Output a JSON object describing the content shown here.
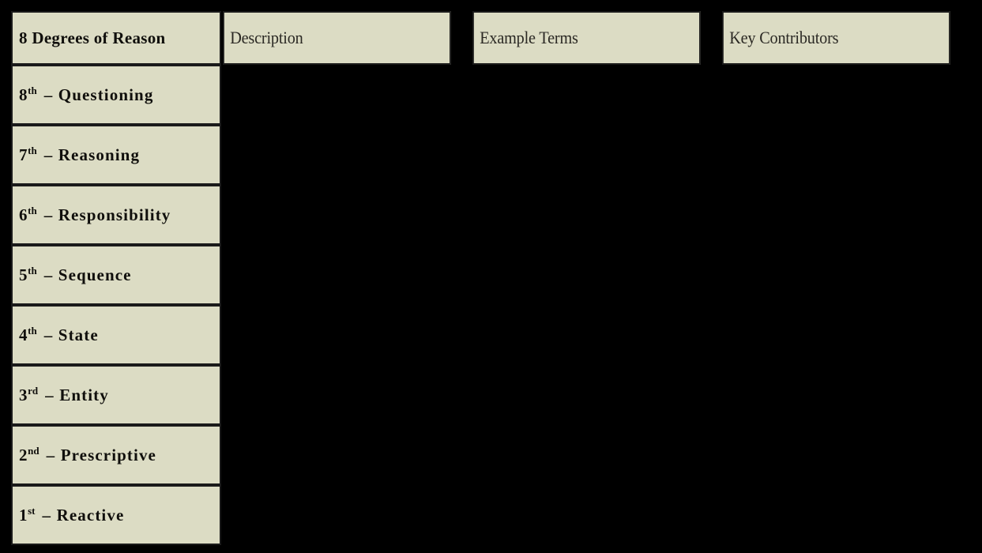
{
  "table": {
    "title_cell": "8 Degrees of Reason",
    "columns": [
      {
        "id": "degrees",
        "label": "8 Degrees of Reason"
      },
      {
        "id": "description",
        "label": "Description"
      },
      {
        "id": "example",
        "label": "Example Terms"
      },
      {
        "id": "key",
        "label": "Key Contributors"
      }
    ],
    "rows": [
      {
        "ordinal": "8",
        "suffix": "th",
        "separator": "–",
        "name": "Questioning",
        "description": "",
        "example_terms": "",
        "key_contributors": ""
      },
      {
        "ordinal": "7",
        "suffix": "th",
        "separator": "–",
        "name": "Reasoning",
        "description": "",
        "example_terms": "",
        "key_contributors": ""
      },
      {
        "ordinal": "6",
        "suffix": "th",
        "separator": "–",
        "name": "Responsibility",
        "description": "",
        "example_terms": "",
        "key_contributors": ""
      },
      {
        "ordinal": "5",
        "suffix": "th",
        "separator": "–",
        "name": "Sequence",
        "description": "",
        "example_terms": "",
        "key_contributors": ""
      },
      {
        "ordinal": "4",
        "suffix": "th",
        "separator": "–",
        "name": "State",
        "description": "",
        "example_terms": "",
        "key_contributors": ""
      },
      {
        "ordinal": "3",
        "suffix": "rd",
        "separator": "–",
        "name": "Entity",
        "description": "",
        "example_terms": "",
        "key_contributors": ""
      },
      {
        "ordinal": "2",
        "suffix": "nd",
        "separator": "–",
        "name": "Prescriptive",
        "description": "",
        "example_terms": "",
        "key_contributors": ""
      },
      {
        "ordinal": "1",
        "suffix": "st",
        "separator": "–",
        "name": "Reactive",
        "description": "",
        "example_terms": "",
        "key_contributors": ""
      }
    ]
  },
  "colors": {
    "cell_background": "#dcdcc4",
    "border": "#1a1a1a",
    "text": "#100f0c",
    "header_text": "#2a2823",
    "slide_background": "#000000"
  }
}
